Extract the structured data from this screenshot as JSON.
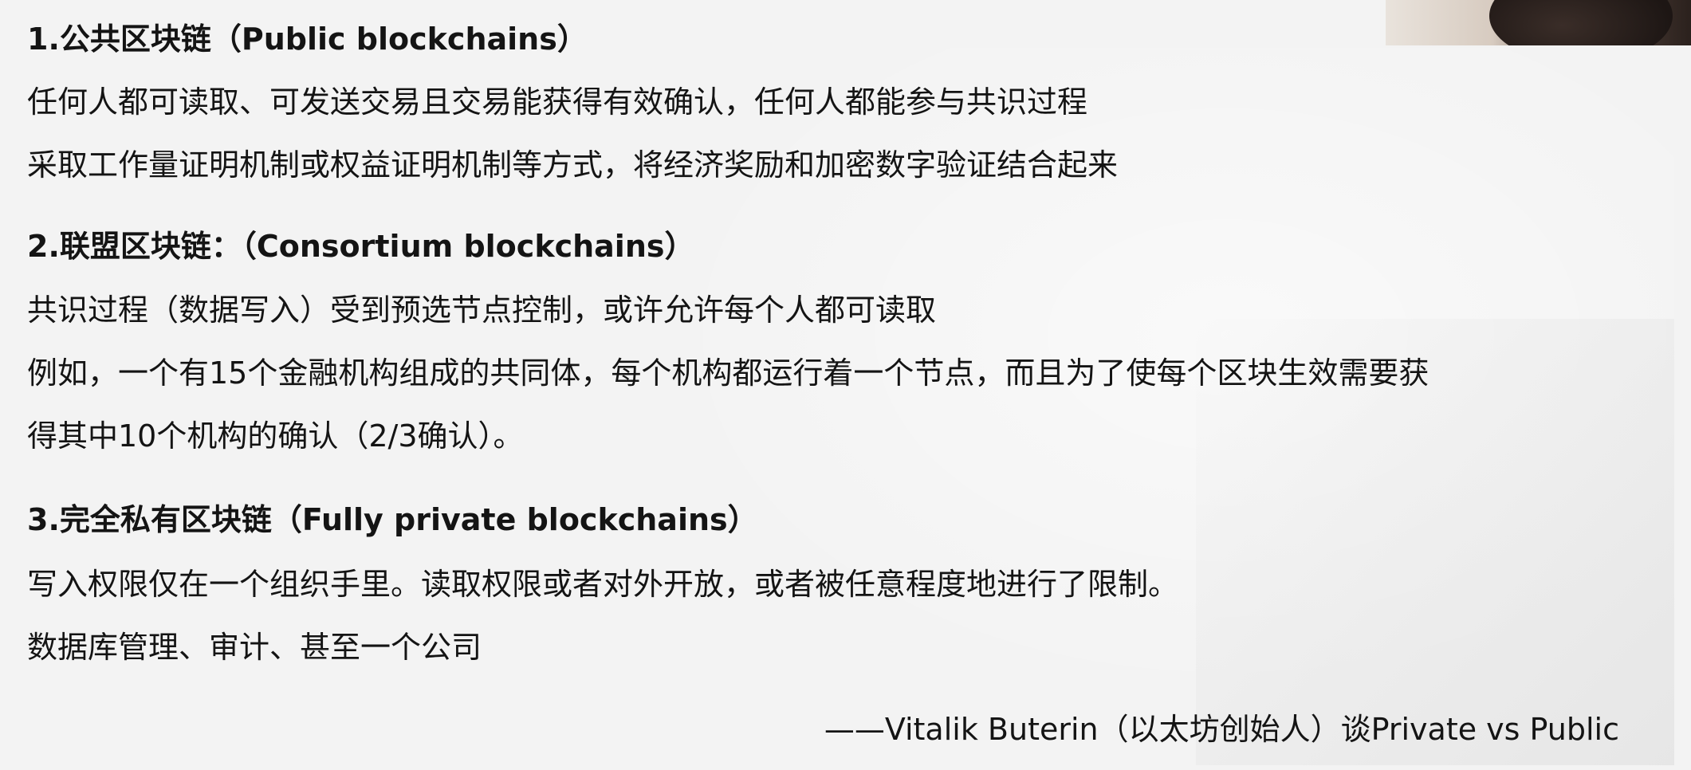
{
  "sections": [
    {
      "title": "1.公共区块链（Public blockchains）",
      "lines": [
        "任何人都可读取、可发送交易且交易能获得有效确认，任何人都能参与共识过程",
        "采取工作量证明机制或权益证明机制等方式，将经济奖励和加密数字验证结合起来"
      ]
    },
    {
      "title": "2.联盟区块链：（Consortium blockchains）",
      "lines": [
        "共识过程（数据写入）受到预选节点控制，或许允许每个人都可读取",
        "例如，一个有15个金融机构组成的共同体，每个机构都运行着一个节点，而且为了使每个区块生效需要获",
        "得其中10个机构的确认（2/3确认）。"
      ]
    },
    {
      "title": "3.完全私有区块链（Fully private blockchains）",
      "lines": [
        "写入权限仅在一个组织手里。读取权限或者对外开放，或者被任意程度地进行了限制。",
        "数据库管理、审计、甚至一个公司"
      ]
    }
  ],
  "quote": "——Vitalik Buterin（以太坊创始人）谈Private vs Public"
}
